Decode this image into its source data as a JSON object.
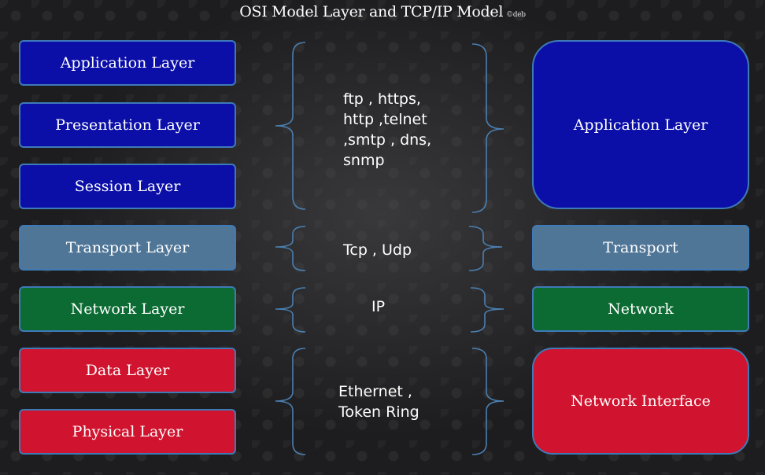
{
  "title": "OSI Model Layer and TCP/IP Model",
  "credit": "©deb",
  "osi_layers": [
    {
      "label": "Application Layer",
      "color": "#0b0fa8"
    },
    {
      "label": "Presentation Layer",
      "color": "#0b0fa8"
    },
    {
      "label": "Session Layer",
      "color": "#0b0fa8"
    },
    {
      "label": "Transport Layer",
      "color": "#4f7597"
    },
    {
      "label": "Network Layer",
      "color": "#0b6b32"
    },
    {
      "label": "Data Layer",
      "color": "#d0132e"
    },
    {
      "label": "Physical Layer",
      "color": "#d0132e"
    }
  ],
  "protocols": [
    {
      "text": "ftp , https,\nhttp ,telnet\n,smtp , dns,\nsnmp"
    },
    {
      "text": "Tcp , Udp"
    },
    {
      "text": "IP"
    },
    {
      "text": "Ethernet ,\nToken Ring"
    }
  ],
  "tcpip_layers": [
    {
      "label": "Application Layer",
      "color": "#0b0fa8"
    },
    {
      "label": "Transport",
      "color": "#4f7597"
    },
    {
      "label": "Network",
      "color": "#0b6b32"
    },
    {
      "label": "Network Interface",
      "color": "#d0132e"
    }
  ],
  "colors": {
    "border": "#3f7ab8",
    "brace": "#4a7fb0"
  }
}
